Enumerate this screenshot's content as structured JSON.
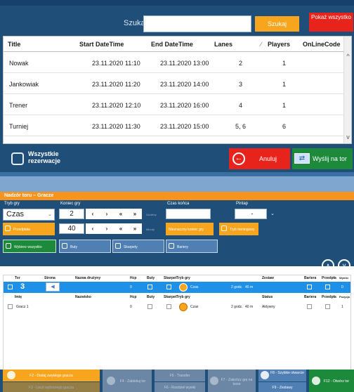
{
  "reservations": {
    "search_label": "Szukaj:",
    "search_value": "",
    "search_button": "Szukaj",
    "show_all_button": "Pokaż wszystko",
    "columns": [
      "Title",
      "Start DateTime",
      "End DateTime",
      "Lanes",
      "Players",
      "OnLineCode"
    ],
    "rows": [
      {
        "title": "Nowak",
        "start": "23.11.2020 11:10",
        "end": "23.11.2020 13:00",
        "lanes": "2",
        "players": "1",
        "code": ""
      },
      {
        "title": "Jankowiak",
        "start": "23.11.2020 11:20",
        "end": "23.11.2020 14:00",
        "lanes": "3",
        "players": "1",
        "code": ""
      },
      {
        "title": "Trener",
        "start": "23.11.2020 12:10",
        "end": "23.11.2020 16:00",
        "lanes": "4",
        "players": "1",
        "code": ""
      },
      {
        "title": "Turniej",
        "start": "23.11.2020 11:30",
        "end": "23.11.2020 15:00",
        "lanes": "5, 6",
        "players": "6",
        "code": ""
      }
    ],
    "all_checkbox_label": "Wszystkie rezerwacje",
    "cancel_button": "Anuluj",
    "send_button": "Wyślij na tor"
  },
  "panel": {
    "title": "Nadzór toru – Gracze",
    "labels": {
      "game_mode": "Tryb gry",
      "game_end": "Koniec gry",
      "end_time": "Czas końca",
      "pintap": "Pintap"
    },
    "game_mode_value": "Czas",
    "pintap_value": "-",
    "end_stepper_1_value": "2",
    "end_stepper_1_unit": "Godziny",
    "end_stepper_2_value": "40",
    "end_stepper_2_unit": "Minuty",
    "stepper_glyphs": [
      "‹",
      "›",
      "«",
      "»"
    ],
    "opt_przedplata": "Przedpłata",
    "opt_unknown_end": "Nieznaczny koniec gry",
    "opt_training": "Tryb treningowy",
    "opt_select_all": "Wybierz wszystko",
    "opt_buty": "Buty",
    "opt_skarpety": "Skarpety",
    "opt_bariery": "Bariery",
    "lane_headers": {
      "tor": "Tor",
      "strona": "Strona",
      "nazwa": "Nazwa drużyny",
      "hcp": "Hcp",
      "buty": "Buty",
      "skarpet": "Skarpet",
      "tryb": "Tryb gry",
      "zestaw": "Zestaw",
      "bariera": "Bariera",
      "przedpla": "Przedpła",
      "wyniki": "Wyniki"
    },
    "lane_row": {
      "tor": "3",
      "hcp": "0",
      "tryb": "Czas",
      "czas": "2 godz.",
      "min": "40 m",
      "wynik": "0"
    },
    "player_headers": {
      "imie": "Imię",
      "nazwisko": "Nazwisko",
      "hcp": "Hcp",
      "buty": "Buty",
      "skarpet": "Skarpet",
      "tryb": "Tryb gry",
      "status": "Status",
      "bariera": "Bariera",
      "przedpla": "Przedpła",
      "pozycja": "Pozycja"
    },
    "player_row": {
      "imie": "Gracz 1",
      "hcp": "0",
      "tryb": "Czas",
      "czas": "2 godz.",
      "min": "40 m",
      "status": "Aktywny",
      "pozycja": "1"
    }
  },
  "function_keys": {
    "f2": "F2 - Dodaj zwykłego gracza",
    "f3": "F3 - Usuń wybranego gracza",
    "f4": "F4 - Zablokuj tor",
    "f5": "F5 - Transfer",
    "f6": "F6 - Rozdziel wyniki",
    "f7": "F7 - Zakończ grę na torze",
    "f8": "F8 - Szybkie otwarcie",
    "f9": "F9 - Zestawy",
    "f12": "F12 - Otwórz tor"
  }
}
